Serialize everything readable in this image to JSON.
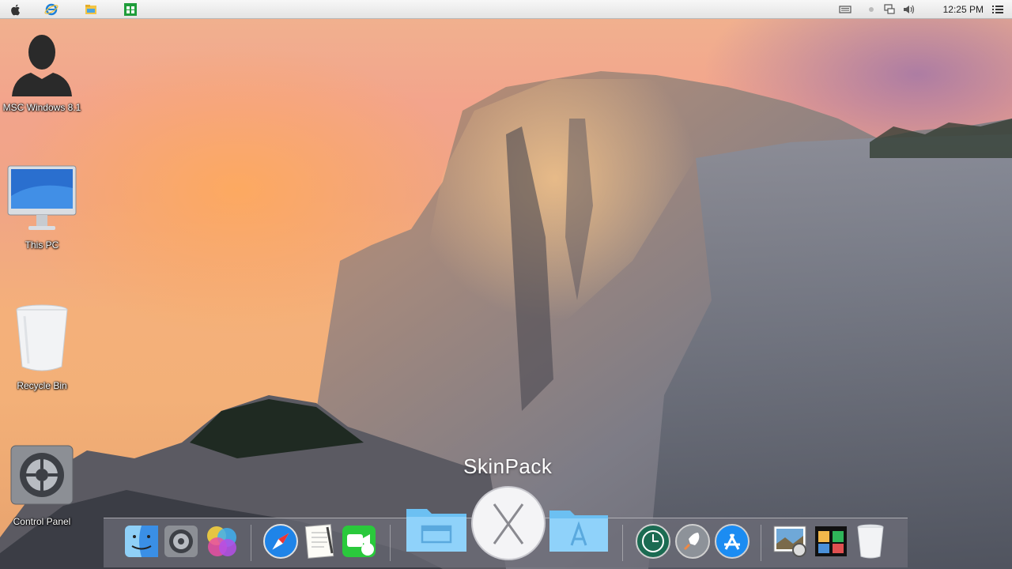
{
  "menubar": {
    "left_icons": [
      "apple-icon",
      "internet-explorer-icon",
      "file-explorer-icon",
      "store-icon"
    ],
    "right_icons": [
      "keyboard-icon",
      "dot-icon",
      "network-icon",
      "volume-icon",
      "menu-list-icon"
    ],
    "clock": "12:25 PM"
  },
  "desktop": {
    "icons": [
      {
        "label": "MSC Windows 8.1",
        "icon": "user-icon"
      },
      {
        "label": "This PC",
        "icon": "monitor-icon"
      },
      {
        "label": "Recycle Bin",
        "icon": "trash-icon"
      },
      {
        "label": "Control Panel",
        "icon": "gear-icon"
      }
    ]
  },
  "dock": {
    "hover_label": "SkinPack",
    "items": [
      "finder-icon",
      "system-preferences-icon",
      "game-center-icon",
      "safari-icon",
      "textedit-icon",
      "facetime-icon",
      "folder-icon",
      "os-x-icon",
      "applications-folder-icon",
      "time-machine-icon",
      "launchpad-icon",
      "app-store-icon",
      "preview-icon",
      "photo-booth-icon",
      "trash-icon"
    ]
  },
  "colors": {
    "menubar": "#e9e9e9",
    "sky": "#f3a48c",
    "dock": "#6e6e78"
  }
}
